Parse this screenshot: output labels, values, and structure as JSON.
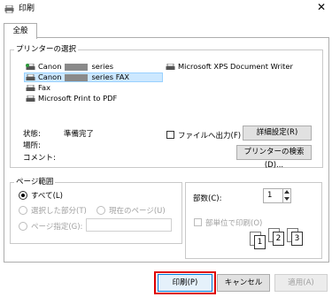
{
  "window": {
    "title": "印刷",
    "close_glyph": "✕"
  },
  "tabs": [
    {
      "label": "全般"
    }
  ],
  "printer_select": {
    "legend": "プリンターの選択",
    "printers": [
      {
        "prefix": "Canon",
        "suffix": "series",
        "icon": "default-printer-icon"
      },
      {
        "prefix": "Canon",
        "suffix": "series FAX",
        "icon": "fax-printer-icon",
        "selected": true
      },
      {
        "prefix": "Fax",
        "suffix": "",
        "icon": "fax-icon"
      },
      {
        "prefix": "Microsoft Print to PDF",
        "suffix": "",
        "icon": "printer-icon"
      },
      {
        "prefix": "Microsoft XPS Document Writer",
        "suffix": "",
        "icon": "printer-icon"
      }
    ],
    "status_label": "状態:",
    "status_value": "準備完了",
    "location_label": "場所:",
    "comment_label": "コメント:",
    "file_output_label": "ファイルへ出力(F)",
    "file_output_checked": false,
    "detail_button": "詳細設定(R)",
    "find_button": "プリンターの検索(D)..."
  },
  "page_range": {
    "legend": "ページ範囲",
    "all_label": "すべて(L)",
    "selection_label": "選択した部分(T)",
    "current_label": "現在のページ(U)",
    "pages_label": "ページ指定(G):",
    "pages_value": "",
    "selected": "all"
  },
  "copies": {
    "label": "部数(C):",
    "value": "1",
    "collate_label": "部単位で印刷(O)",
    "collate_checked": false,
    "collate_digits": [
      "1",
      "1",
      "2",
      "2",
      "3",
      "3"
    ]
  },
  "buttons": {
    "print": "印刷(P)",
    "cancel": "キャンセル",
    "apply": "適用(A)"
  },
  "colors": {
    "highlight": "#cce8ff",
    "highlight_border": "#99d1ff",
    "print_outline": "#e00000"
  }
}
